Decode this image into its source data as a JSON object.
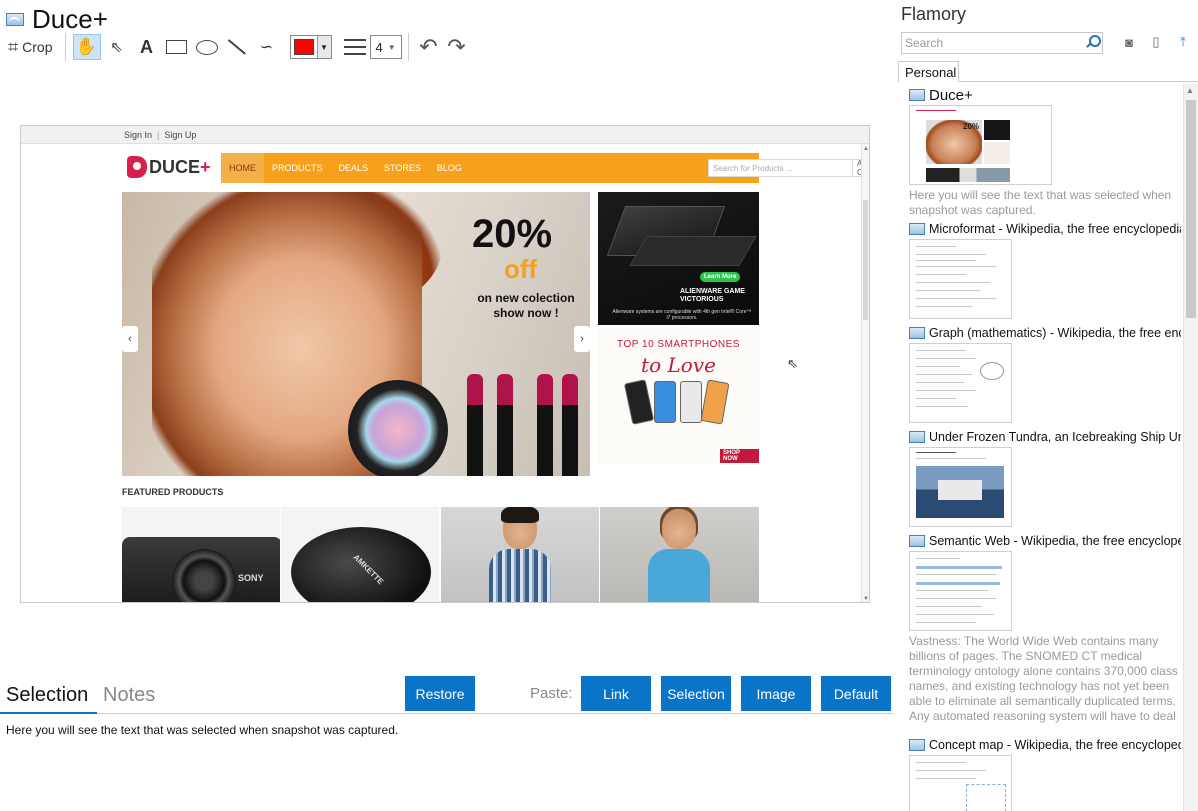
{
  "app": {
    "title": "Duce+",
    "toolbar": {
      "crop_label": "Crop",
      "tools": [
        "hand-icon",
        "pointer-icon",
        "text-icon",
        "rectangle-icon",
        "ellipse-icon",
        "line-icon",
        "freehand-icon"
      ],
      "text_tool_glyph": "A",
      "active_color": "#ff0000",
      "line_width": "4"
    }
  },
  "snapshot": {
    "topbar": {
      "signin": "Sign In",
      "separator": "|",
      "signup": "Sign Up"
    },
    "logo": {
      "text": "DUCE",
      "plus": "+"
    },
    "nav": [
      "HOME",
      "PRODUCTS",
      "DEALS",
      "STORES",
      "BLOG"
    ],
    "search_placeholder": "Search for Products ...",
    "category": "All Categories",
    "hero": {
      "big": "20%",
      "off": "off",
      "sub": "on new colection show now !"
    },
    "ad1": {
      "button": "Learn More",
      "brand": "ALIENWARE GAME VICTORIOUS",
      "small": "Alienware systems are configurable with 4th gen Intel® Core™ i7 processors."
    },
    "ad2": {
      "line1": "TOP 10 SMARTPHONES",
      "line2": "to Love",
      "shop": "SHOP NOW"
    },
    "featured_title": "FEATURED PRODUCTS",
    "camera_brand": "SONY",
    "speaker_brand": "AMKETTE"
  },
  "bottom": {
    "tabs": {
      "selection": "Selection",
      "notes": "Notes"
    },
    "restore": "Restore",
    "paste_label": "Paste:",
    "paste_buttons": {
      "link": "Link",
      "selection": "Selection",
      "image": "Image",
      "default": "Default"
    },
    "selection_text": "Here you will see the text that was selected when snapshot was captured."
  },
  "sidebar": {
    "title": "Flamory",
    "search_placeholder": "Search",
    "tab": "Personal",
    "entries": [
      {
        "title": "Duce+",
        "desc": "Here you will see the text that was selected when snapshot was captured."
      },
      {
        "title": "Microformat - Wikipedia, the free encyclopedia",
        "desc": ""
      },
      {
        "title": "Graph (mathematics) - Wikipedia, the free ency",
        "desc": ""
      },
      {
        "title": "Under Frozen Tundra, an Icebreaking Ship Unco",
        "desc": ""
      },
      {
        "title": "Semantic Web - Wikipedia, the free encycloped",
        "desc": "Vastness: The World Wide Web contains many billions of pages. The SNOMED CT medical terminology ontology alone contains 370,000 class names, and existing technology has not yet been able to eliminate all semantically duplicated terms. Any automated reasoning system will have to deal with truly huge inputs."
      },
      {
        "title": "Concept map - Wikipedia, the free encyclopedi",
        "desc": ""
      }
    ]
  }
}
